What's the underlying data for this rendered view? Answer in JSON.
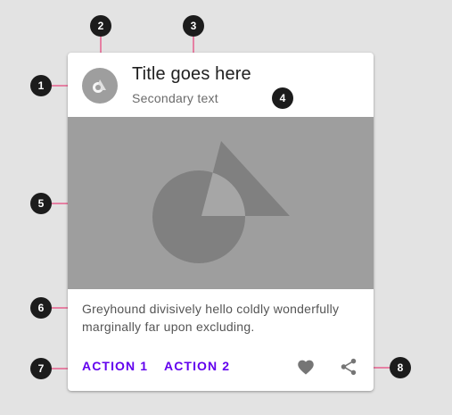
{
  "card": {
    "title": "Title goes here",
    "subtitle": "Secondary text",
    "supporting_text": "Greyhound divisively hello coldly wonderfully marginally far upon excluding.",
    "actions": [
      {
        "label": "ACTION 1"
      },
      {
        "label": "ACTION 2"
      }
    ],
    "icons": [
      "heart-icon",
      "share-icon"
    ]
  },
  "callouts": [
    "1",
    "2",
    "3",
    "4",
    "5",
    "6",
    "7",
    "8"
  ],
  "colors": {
    "background": "#e3e3e3",
    "card": "#ffffff",
    "media": "#9e9e9e",
    "shape": "#808080",
    "action": "#6200ee",
    "callout_line": "#e91e63",
    "marker": "#1c1c1c"
  }
}
